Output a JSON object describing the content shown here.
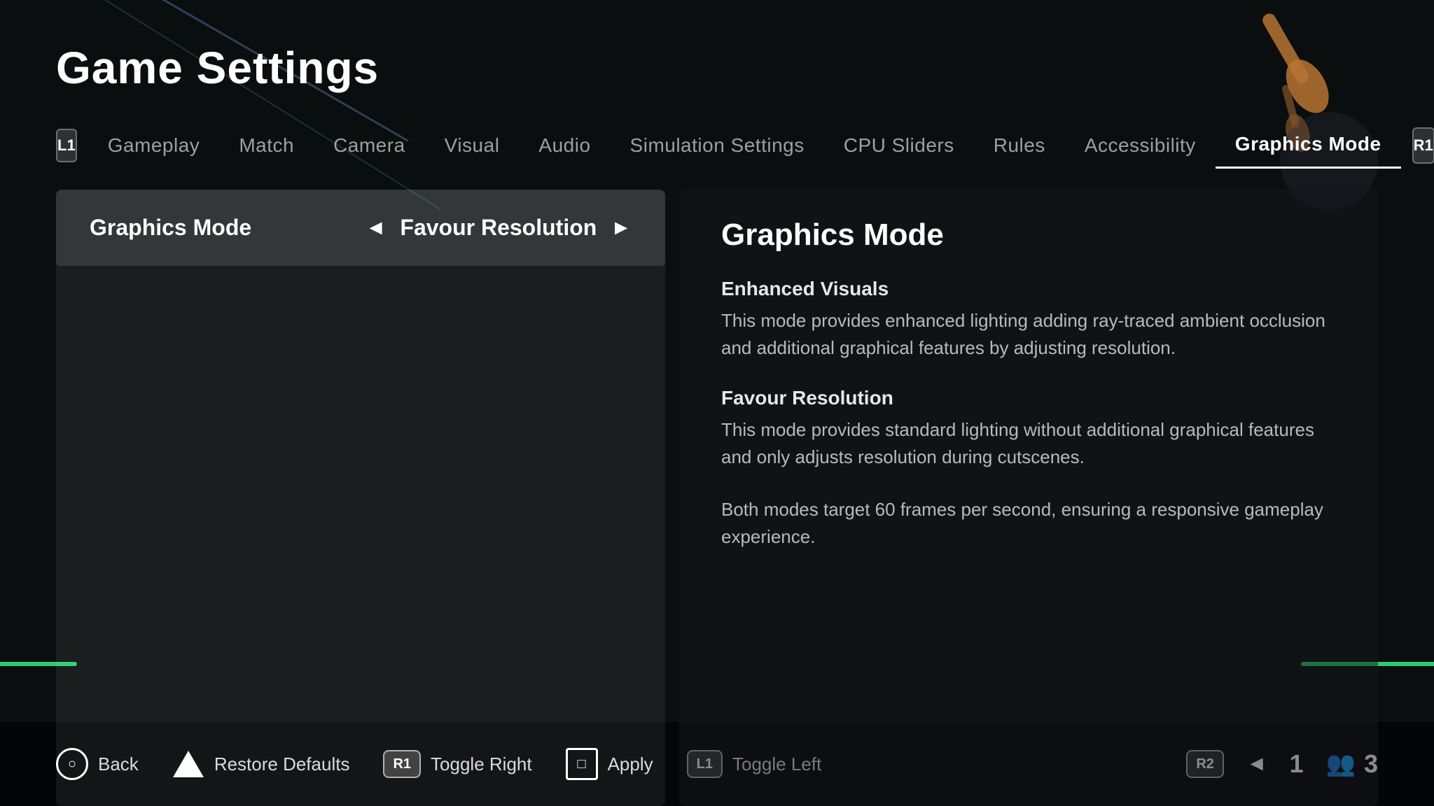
{
  "page": {
    "title": "Game Settings",
    "background_color": "#0a0e0f"
  },
  "tabs": {
    "l1_label": "L1",
    "r1_label": "R1",
    "items": [
      {
        "id": "gameplay",
        "label": "Gameplay",
        "active": false
      },
      {
        "id": "match",
        "label": "Match",
        "active": false
      },
      {
        "id": "camera",
        "label": "Camera",
        "active": false
      },
      {
        "id": "visual",
        "label": "Visual",
        "active": false
      },
      {
        "id": "audio",
        "label": "Audio",
        "active": false
      },
      {
        "id": "simulation-settings",
        "label": "Simulation Settings",
        "active": false
      },
      {
        "id": "cpu-sliders",
        "label": "CPU Sliders",
        "active": false
      },
      {
        "id": "rules",
        "label": "Rules",
        "active": false
      },
      {
        "id": "accessibility",
        "label": "Accessibility",
        "active": false
      },
      {
        "id": "graphics-mode",
        "label": "Graphics Mode",
        "active": true
      }
    ]
  },
  "left_panel": {
    "setting_label": "Graphics Mode",
    "setting_value": "Favour Resolution",
    "arrow_left": "◄",
    "arrow_right": "►"
  },
  "right_panel": {
    "title": "Graphics Mode",
    "section1_title": "Enhanced Visuals",
    "section1_text": "This mode provides enhanced lighting adding ray-traced ambient occlusion and additional graphical features by adjusting resolution.",
    "section2_title": "Favour Resolution",
    "section2_text": "This mode provides standard lighting without additional graphical features and only adjusts resolution during cutscenes.",
    "footer_text": "Both modes target 60 frames per second, ensuring a responsive gameplay experience."
  },
  "bottom_bar": {
    "back_badge": "○",
    "back_label": "Back",
    "restore_badge": "△",
    "restore_label": "Restore Defaults",
    "toggle_right_badge": "R1",
    "toggle_right_label": "Toggle Right",
    "apply_badge": "□",
    "apply_label": "Apply",
    "toggle_left_badge": "L1",
    "toggle_left_label": "Toggle Left",
    "r2_badge": "R2",
    "nav_arrow": "◄",
    "player_num": "1",
    "players_count": "3"
  }
}
